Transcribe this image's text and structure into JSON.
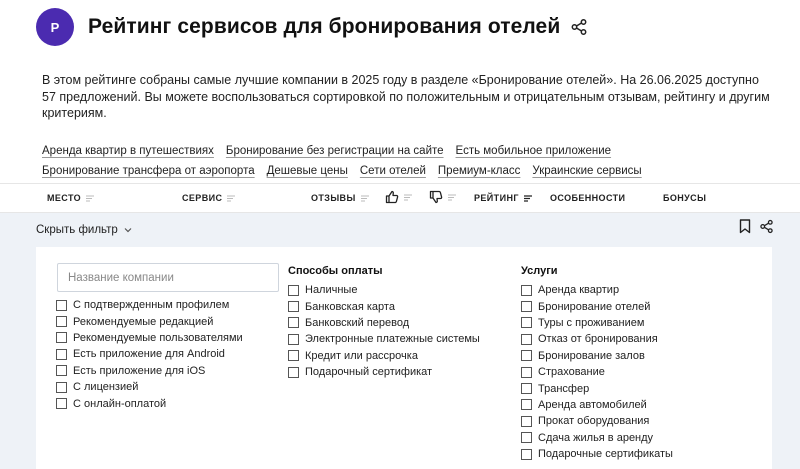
{
  "header": {
    "avatar_letter": "P",
    "title": "Рейтинг сервисов для бронирования отелей",
    "share_icon": "share-icon"
  },
  "description": "В этом рейтинге собраны самые лучшие компании в 2025 году в разделе «Бронирование отелей». На 26.06.2025 доступно 57 предложений. Вы можете воспользоваться сортировкой по положительным и отрицательным отзывам, рейтингу и другим критериям.",
  "tags": {
    "row1": [
      "Аренда квартир в путешествиях",
      "Бронирование без регистрации на сайте",
      "Есть мобильное приложение"
    ],
    "row2": [
      "Бронирование трансфера от аэропорта",
      "Дешевые цены",
      "Сети отелей",
      "Премиум-класс",
      "Украинские сервисы"
    ]
  },
  "columns": {
    "place": "МЕСТО",
    "service": "СЕРВИС",
    "reviews": "ОТЗЫВЫ",
    "rating": "РЕЙТИНГ",
    "features": "ОСОБЕННОСТИ",
    "bonuses": "БОНУСЫ"
  },
  "filter": {
    "toggle_label": "Скрыть фильтр",
    "search_placeholder": "Название компании",
    "general_options": [
      "С подтвержденным профилем",
      "Рекомендуемые редакцией",
      "Рекомендуемые пользователями",
      "Есть приложение для Android",
      "Есть приложение для iOS",
      "С лицензией",
      "С онлайн-оплатой"
    ],
    "payment": {
      "title": "Способы оплаты",
      "options": [
        "Наличные",
        "Банковская карта",
        "Банковский перевод",
        "Электронные платежные системы",
        "Кредит или рассрочка",
        "Подарочный сертификат"
      ]
    },
    "services": {
      "title": "Услуги",
      "options": [
        "Аренда квартир",
        "Бронирование отелей",
        "Туры с проживанием",
        "Отказ от бронирования",
        "Бронирование залов",
        "Страхование",
        "Трансфер",
        "Аренда автомобилей",
        "Прокат оборудования",
        "Сдача жилья в аренду",
        "Подарочные сертификаты"
      ]
    }
  },
  "colors": {
    "accent": "#4b2bb0",
    "panel_bg": "#eef2f7"
  }
}
